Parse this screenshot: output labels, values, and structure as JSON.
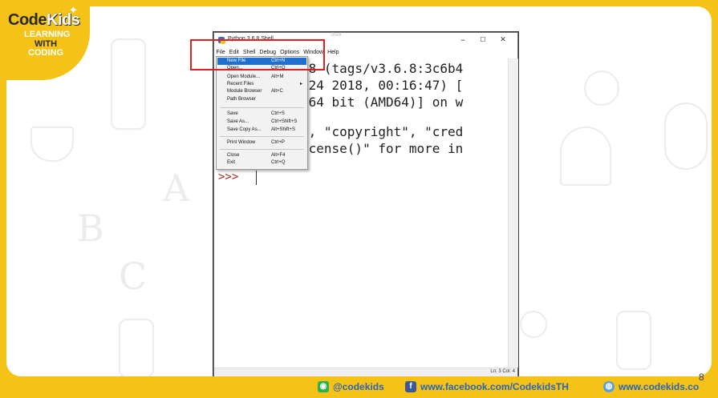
{
  "logo": {
    "code": "Code",
    "kids": "Kids",
    "line1": "LEARNING",
    "line2": "WITH",
    "line3": "CODING"
  },
  "window": {
    "title": "Python 3.6.8 Shell",
    "ghost_title": "Shell",
    "minimize": "–",
    "maximize": "☐",
    "close": "✕",
    "menus": [
      "File",
      "Edit",
      "Shell",
      "Debug",
      "Options",
      "Window",
      "Help"
    ],
    "code_lines": [
      ".8 (tags/v3.6.8:3c6b4",
      " 24 2018, 00:16:47) [",
      " 64 bit (AMD64)] on w",
      "\", \"copyright\", \"cred",
      "icense()\" for more in"
    ],
    "prompt": ">>>",
    "status": "Ln: 3  Col: 4"
  },
  "file_menu": [
    {
      "label": "New File",
      "shortcut": "Ctrl+N",
      "active": true
    },
    {
      "label": "Open...",
      "shortcut": "Ctrl+O"
    },
    {
      "label": "Open Module...",
      "shortcut": "Alt+M"
    },
    {
      "label": "Recent Files",
      "shortcut": "",
      "submenu": "▸"
    },
    {
      "label": "Module Browser",
      "shortcut": "Alt+C"
    },
    {
      "label": "Path Browser",
      "shortcut": ""
    },
    {
      "label": "Save",
      "shortcut": "Ctrl+S"
    },
    {
      "label": "Save As...",
      "shortcut": "Ctrl+Shift+S"
    },
    {
      "label": "Save Copy As...",
      "shortcut": "Alt+Shift+S"
    },
    {
      "label": "Print Window",
      "shortcut": "Ctrl+P"
    },
    {
      "label": "Close",
      "shortcut": "Alt+F4"
    },
    {
      "label": "Exit",
      "shortcut": "Ctrl+Q"
    }
  ],
  "footer": {
    "line": "@codekids",
    "facebook": "www.facebook.com/CodekidsTH",
    "website": "www.codekids.co",
    "page_number": "8"
  },
  "colors": {
    "brand_yellow": "#f5c318",
    "highlight_red": "#e02020",
    "menu_active": "#1f6fd1",
    "prompt_red": "#b22222"
  }
}
